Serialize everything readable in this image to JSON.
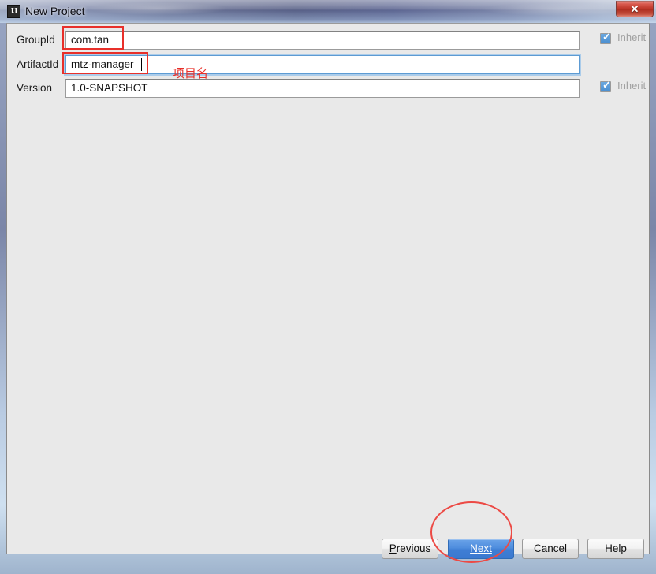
{
  "window": {
    "title": "New Project",
    "app_icon": "IJ",
    "close_label": "✕",
    "close_icon": "close-icon"
  },
  "form": {
    "rows": [
      {
        "label": "GroupId",
        "value": "com.tan",
        "placeholder": "",
        "focused": false,
        "inherit": {
          "label": "Inherit",
          "checked": true,
          "check_glyph": "✓"
        }
      },
      {
        "label": "ArtifactId",
        "value": "mtz-manager",
        "placeholder": "",
        "focused": true,
        "inherit": null
      },
      {
        "label": "Version",
        "value": "1.0-SNAPSHOT",
        "placeholder": "",
        "focused": false,
        "inherit": {
          "label": "Inherit",
          "checked": true,
          "check_glyph": "✓"
        }
      }
    ]
  },
  "buttons": {
    "previous": {
      "label": "Previous",
      "mnemonic": "P",
      "rest": "revious"
    },
    "next": {
      "label": "Next",
      "mnemonic": "N",
      "rest": "ext"
    },
    "cancel": {
      "label": "Cancel"
    },
    "help": {
      "label": "Help"
    }
  },
  "annotations": {
    "note_text": "项目名",
    "color": "#e8302a"
  },
  "colors": {
    "accent": "#3f7ed4",
    "annotation_red": "#e8302a",
    "checkbox_blue": "#4a8ed0",
    "panel_bg": "#e9e9e9",
    "close_red": "#bb3326"
  }
}
